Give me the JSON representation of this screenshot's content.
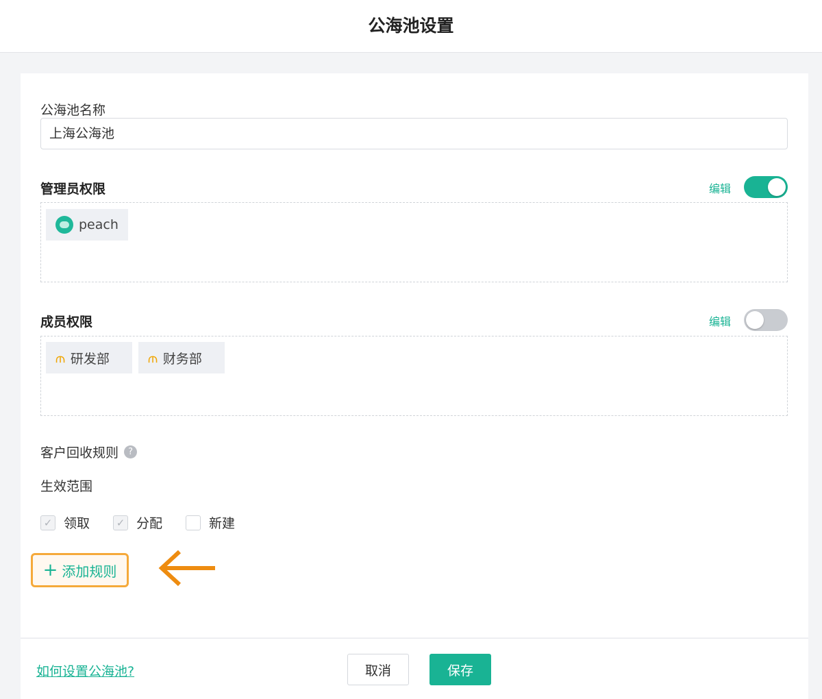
{
  "header": {
    "title": "公海池设置"
  },
  "pool_name": {
    "label": "公海池名称",
    "value": "上海公海池"
  },
  "admin": {
    "label": "管理员权限",
    "edit_label": "编辑",
    "toggle_on": true,
    "members": [
      {
        "name": "peach",
        "icon": "avatar-icon"
      }
    ]
  },
  "member": {
    "label": "成员权限",
    "edit_label": "编辑",
    "toggle_on": false,
    "departments": [
      {
        "name": "研发部",
        "icon": "org-chart-icon"
      },
      {
        "name": "财务部",
        "icon": "org-chart-icon"
      }
    ]
  },
  "recycle": {
    "label": "客户回收规则",
    "help_icon": "question-icon",
    "scope_label": "生效范围",
    "options": [
      {
        "label": "领取",
        "checked": true
      },
      {
        "label": "分配",
        "checked": true
      },
      {
        "label": "新建",
        "checked": false
      }
    ],
    "add_rule_label": "添加规则"
  },
  "footer": {
    "help_link": "如何设置公海池?",
    "cancel_label": "取消",
    "save_label": "保存"
  },
  "colors": {
    "accent": "#19b394",
    "highlight": "#f5a93a",
    "arrow": "#ee8c10"
  }
}
